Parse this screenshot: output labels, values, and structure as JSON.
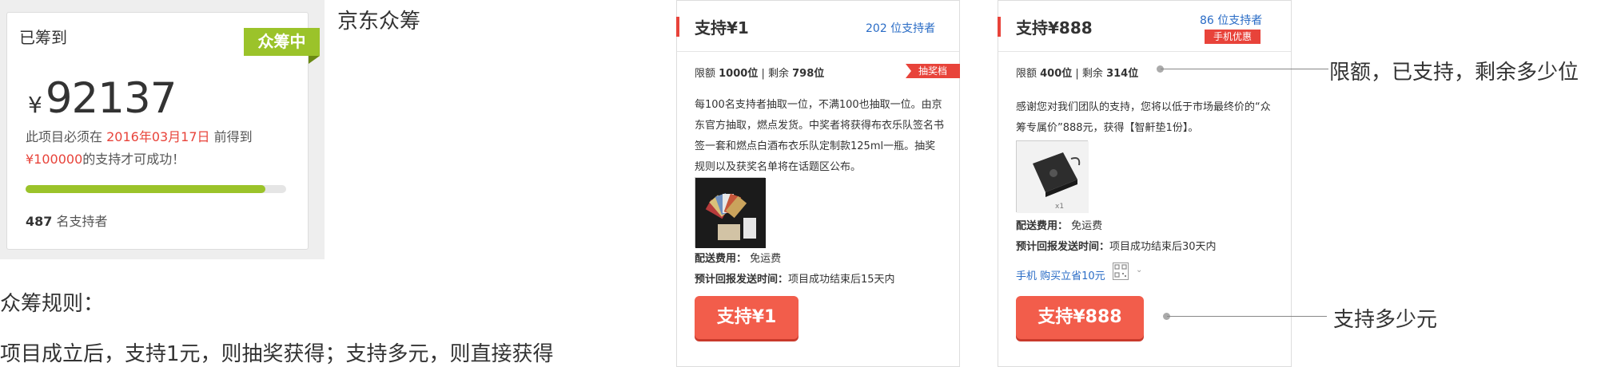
{
  "summary": {
    "title": "已筹到",
    "status_badge": "众筹中",
    "currency": "¥",
    "amount": "92137",
    "deadline_prefix": "此项目必须在 ",
    "deadline_date": "2016年03月17日",
    "deadline_suffix": " 前得到",
    "goal_amount": "¥100000",
    "goal_suffix": "的支持才可成功！",
    "progress_fraction": 0.921,
    "supporters_count": "487",
    "supporters_label": " 名支持者",
    "colors": {
      "accent": "#9bc32a",
      "highlight": "#e8433a"
    }
  },
  "labels": {
    "jd": "京东众筹",
    "rules_title": "众筹规则：",
    "rules_text": "项目成立后，支持1元，则抽奖获得；支持多元，则直接获得"
  },
  "tiers": [
    {
      "title": "支持¥1",
      "backers": "202 位支持者",
      "quota_label": "限额 ",
      "quota_value": "1000位",
      "remaining_label": " | 剩余 ",
      "remaining_value": "798位",
      "tag": "抽奖档",
      "description": "每100名支持者抽取一位，不满100也抽取一位。由京东官方抽取，燃点发货。中奖者将获得布衣乐队签名书签一套和燃点白酒布衣乐队定制款125ml一瓶。抽奖规则以及获奖名单将在话题区公布。",
      "shipping_label": "配送费用：",
      "shipping_value": "免运费",
      "delivery_label": "预计回报发送时间：",
      "delivery_value": "项目成功结束后15天内",
      "button": "支持¥1"
    },
    {
      "title": "支持¥888",
      "backers": "86 位支持者",
      "tag": "手机优惠",
      "quota_label": "限额 ",
      "quota_value": "400位",
      "remaining_label": " | 剩余 ",
      "remaining_value": "314位",
      "description": "感谢您对我们团队的支持，您将以低于市场最终价的“众筹专属价”888元，获得【智鼾垫1份】。",
      "photo_caption": "x1",
      "shipping_label": "配送费用：",
      "shipping_value": "免运费",
      "delivery_label": "预计回报发送时间：",
      "delivery_value": "项目成功结束后30天内",
      "mobile_promo": "手机 购买立省10元",
      "button": "支持¥888"
    }
  ],
  "annotations": {
    "quota_note": "限额，已支持，剩余多少位",
    "amount_note": "支持多少元"
  },
  "icons": [
    "qr-code-icon",
    "chevron-down-icon"
  ]
}
